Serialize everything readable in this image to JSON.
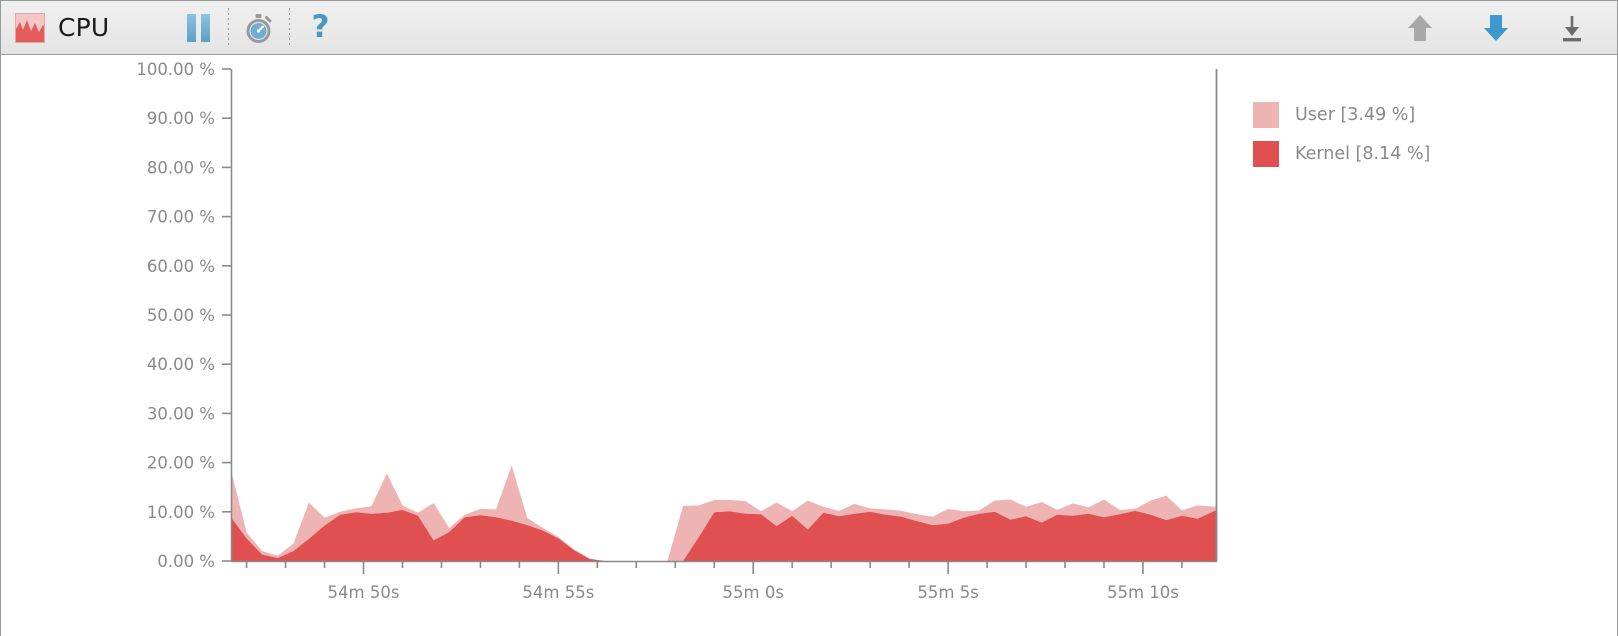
{
  "window": {
    "app_icon": "area-chart-icon",
    "title": "CPU"
  },
  "toolbar": {
    "pause_label": "",
    "pause_icon": "pause-icon",
    "timer_icon": "stopwatch-icon",
    "help_label": "?",
    "help_icon": "question-mark-icon",
    "scroll_up_icon": "arrow-up-icon",
    "scroll_down_icon": "arrow-down-icon",
    "jump_to_end_icon": "download-to-line-icon"
  },
  "legend": {
    "items": [
      {
        "label": "User [3.49 %]",
        "color": "#eeb3b3",
        "name": "legend-item-user"
      },
      {
        "label": "Kernel [8.14 %]",
        "color": "#e05050",
        "name": "legend-item-kernel"
      }
    ]
  },
  "colors": {
    "user": "#eeb3b3",
    "kernel": "#e05050",
    "axis": "#8a8a8a",
    "toolbar_bg": "#eaeaea",
    "accent_blue": "#4a97c2",
    "disabled_gray": "#a9a9a9"
  },
  "chart_data": {
    "type": "area",
    "stacked": true,
    "title": "CPU",
    "xlabel": "",
    "ylabel": "",
    "ylim": [
      0,
      100
    ],
    "yticks": [
      0,
      10,
      20,
      30,
      40,
      50,
      60,
      70,
      80,
      90,
      100
    ],
    "ytick_labels": [
      "0.00 %",
      "10.00 %",
      "20.00 %",
      "30.00 %",
      "40.00 %",
      "50.00 %",
      "60.00 %",
      "70.00 %",
      "80.00 %",
      "90.00 %",
      "100.00 %"
    ],
    "xtick_labels": [
      "54m 50s",
      "54m 55s",
      "55m 0s",
      "55m 5s",
      "55m 10s"
    ],
    "xtick_positions": [
      50,
      55,
      60,
      65,
      70
    ],
    "xlim": [
      46.6,
      71.9
    ],
    "minor_ticks_per_interval": 5,
    "grid": false,
    "legend_position": "right",
    "x": [
      46.6,
      47.0,
      47.4,
      47.8,
      48.2,
      48.6,
      49.0,
      49.4,
      49.8,
      50.2,
      50.6,
      51.0,
      51.4,
      51.8,
      52.2,
      52.6,
      53.0,
      53.4,
      53.8,
      54.2,
      54.6,
      55.0,
      55.4,
      55.8,
      56.2,
      56.6,
      57.0,
      57.4,
      57.8,
      58.2,
      58.6,
      59.0,
      59.4,
      59.8,
      60.2,
      60.6,
      61.0,
      61.4,
      61.8,
      62.2,
      62.6,
      63.0,
      63.4,
      63.8,
      64.2,
      64.6,
      65.0,
      65.4,
      65.8,
      66.2,
      66.6,
      67.0,
      67.4,
      67.8,
      68.2,
      68.6,
      69.0,
      69.4,
      69.8,
      70.2,
      70.6,
      71.0,
      71.4,
      71.9
    ],
    "series": [
      {
        "name": "Kernel",
        "color": "#e05050",
        "values": [
          8.9,
          4.6,
          1.3,
          0.6,
          2.0,
          4.5,
          7.2,
          9.4,
          9.9,
          9.6,
          9.8,
          10.4,
          9.2,
          4.2,
          5.9,
          8.9,
          9.3,
          8.9,
          8.2,
          7.3,
          6.2,
          4.6,
          2.2,
          0.4,
          0.0,
          0.0,
          0.0,
          0.0,
          0.0,
          0.0,
          4.8,
          9.9,
          10.1,
          9.6,
          9.5,
          7.1,
          9.2,
          6.4,
          9.8,
          9.1,
          9.6,
          10.0,
          9.4,
          9.0,
          8.1,
          7.3,
          7.6,
          8.8,
          9.6,
          10.0,
          8.4,
          9.1,
          7.8,
          9.4,
          9.2,
          9.6,
          8.9,
          9.5,
          10.2,
          9.4,
          8.3,
          9.2,
          8.6,
          10.4
        ]
      },
      {
        "name": "User",
        "color": "#eeb3b3",
        "values": [
          9.6,
          1.2,
          0.7,
          0.5,
          1.5,
          7.4,
          1.6,
          0.6,
          0.8,
          1.5,
          8.0,
          0.9,
          0.6,
          7.6,
          0.8,
          0.5,
          1.3,
          1.6,
          11.2,
          1.5,
          0.5,
          0.3,
          0.2,
          0.1,
          0.0,
          0.0,
          0.0,
          0.0,
          0.0,
          11.2,
          6.5,
          2.5,
          2.3,
          2.6,
          0.6,
          4.8,
          0.9,
          5.9,
          1.2,
          1.1,
          2.0,
          0.7,
          1.1,
          1.2,
          1.4,
          1.7,
          3.0,
          1.3,
          0.7,
          2.3,
          4.1,
          1.9,
          4.2,
          1.0,
          2.5,
          1.3,
          3.6,
          0.9,
          0.4,
          2.9,
          5.0,
          1.1,
          2.7,
          0.6
        ]
      }
    ]
  }
}
